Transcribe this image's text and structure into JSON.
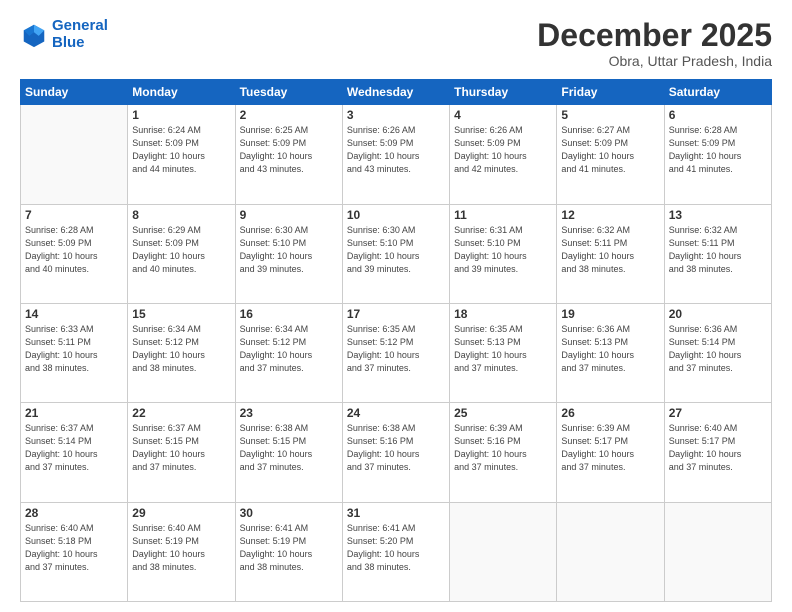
{
  "header": {
    "logo_line1": "General",
    "logo_line2": "Blue",
    "month": "December 2025",
    "location": "Obra, Uttar Pradesh, India"
  },
  "days_of_week": [
    "Sunday",
    "Monday",
    "Tuesday",
    "Wednesday",
    "Thursday",
    "Friday",
    "Saturday"
  ],
  "weeks": [
    [
      {
        "day": "",
        "info": ""
      },
      {
        "day": "1",
        "info": "Sunrise: 6:24 AM\nSunset: 5:09 PM\nDaylight: 10 hours\nand 44 minutes."
      },
      {
        "day": "2",
        "info": "Sunrise: 6:25 AM\nSunset: 5:09 PM\nDaylight: 10 hours\nand 43 minutes."
      },
      {
        "day": "3",
        "info": "Sunrise: 6:26 AM\nSunset: 5:09 PM\nDaylight: 10 hours\nand 43 minutes."
      },
      {
        "day": "4",
        "info": "Sunrise: 6:26 AM\nSunset: 5:09 PM\nDaylight: 10 hours\nand 42 minutes."
      },
      {
        "day": "5",
        "info": "Sunrise: 6:27 AM\nSunset: 5:09 PM\nDaylight: 10 hours\nand 41 minutes."
      },
      {
        "day": "6",
        "info": "Sunrise: 6:28 AM\nSunset: 5:09 PM\nDaylight: 10 hours\nand 41 minutes."
      }
    ],
    [
      {
        "day": "7",
        "info": "Sunrise: 6:28 AM\nSunset: 5:09 PM\nDaylight: 10 hours\nand 40 minutes."
      },
      {
        "day": "8",
        "info": "Sunrise: 6:29 AM\nSunset: 5:09 PM\nDaylight: 10 hours\nand 40 minutes."
      },
      {
        "day": "9",
        "info": "Sunrise: 6:30 AM\nSunset: 5:10 PM\nDaylight: 10 hours\nand 39 minutes."
      },
      {
        "day": "10",
        "info": "Sunrise: 6:30 AM\nSunset: 5:10 PM\nDaylight: 10 hours\nand 39 minutes."
      },
      {
        "day": "11",
        "info": "Sunrise: 6:31 AM\nSunset: 5:10 PM\nDaylight: 10 hours\nand 39 minutes."
      },
      {
        "day": "12",
        "info": "Sunrise: 6:32 AM\nSunset: 5:11 PM\nDaylight: 10 hours\nand 38 minutes."
      },
      {
        "day": "13",
        "info": "Sunrise: 6:32 AM\nSunset: 5:11 PM\nDaylight: 10 hours\nand 38 minutes."
      }
    ],
    [
      {
        "day": "14",
        "info": "Sunrise: 6:33 AM\nSunset: 5:11 PM\nDaylight: 10 hours\nand 38 minutes."
      },
      {
        "day": "15",
        "info": "Sunrise: 6:34 AM\nSunset: 5:12 PM\nDaylight: 10 hours\nand 38 minutes."
      },
      {
        "day": "16",
        "info": "Sunrise: 6:34 AM\nSunset: 5:12 PM\nDaylight: 10 hours\nand 37 minutes."
      },
      {
        "day": "17",
        "info": "Sunrise: 6:35 AM\nSunset: 5:12 PM\nDaylight: 10 hours\nand 37 minutes."
      },
      {
        "day": "18",
        "info": "Sunrise: 6:35 AM\nSunset: 5:13 PM\nDaylight: 10 hours\nand 37 minutes."
      },
      {
        "day": "19",
        "info": "Sunrise: 6:36 AM\nSunset: 5:13 PM\nDaylight: 10 hours\nand 37 minutes."
      },
      {
        "day": "20",
        "info": "Sunrise: 6:36 AM\nSunset: 5:14 PM\nDaylight: 10 hours\nand 37 minutes."
      }
    ],
    [
      {
        "day": "21",
        "info": "Sunrise: 6:37 AM\nSunset: 5:14 PM\nDaylight: 10 hours\nand 37 minutes."
      },
      {
        "day": "22",
        "info": "Sunrise: 6:37 AM\nSunset: 5:15 PM\nDaylight: 10 hours\nand 37 minutes."
      },
      {
        "day": "23",
        "info": "Sunrise: 6:38 AM\nSunset: 5:15 PM\nDaylight: 10 hours\nand 37 minutes."
      },
      {
        "day": "24",
        "info": "Sunrise: 6:38 AM\nSunset: 5:16 PM\nDaylight: 10 hours\nand 37 minutes."
      },
      {
        "day": "25",
        "info": "Sunrise: 6:39 AM\nSunset: 5:16 PM\nDaylight: 10 hours\nand 37 minutes."
      },
      {
        "day": "26",
        "info": "Sunrise: 6:39 AM\nSunset: 5:17 PM\nDaylight: 10 hours\nand 37 minutes."
      },
      {
        "day": "27",
        "info": "Sunrise: 6:40 AM\nSunset: 5:17 PM\nDaylight: 10 hours\nand 37 minutes."
      }
    ],
    [
      {
        "day": "28",
        "info": "Sunrise: 6:40 AM\nSunset: 5:18 PM\nDaylight: 10 hours\nand 37 minutes."
      },
      {
        "day": "29",
        "info": "Sunrise: 6:40 AM\nSunset: 5:19 PM\nDaylight: 10 hours\nand 38 minutes."
      },
      {
        "day": "30",
        "info": "Sunrise: 6:41 AM\nSunset: 5:19 PM\nDaylight: 10 hours\nand 38 minutes."
      },
      {
        "day": "31",
        "info": "Sunrise: 6:41 AM\nSunset: 5:20 PM\nDaylight: 10 hours\nand 38 minutes."
      },
      {
        "day": "",
        "info": ""
      },
      {
        "day": "",
        "info": ""
      },
      {
        "day": "",
        "info": ""
      }
    ]
  ]
}
